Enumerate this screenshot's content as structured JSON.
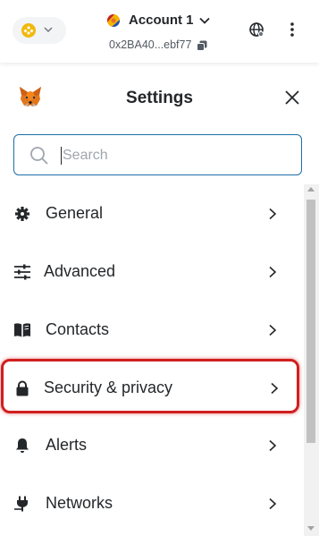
{
  "header": {
    "account_name": "Account 1",
    "account_address": "0x2BA40...ebf77",
    "network_icon": "bnb-chain-icon",
    "colors": {
      "network": "#f0b90b"
    }
  },
  "settings": {
    "title": "Settings",
    "search_placeholder": "Search"
  },
  "menu": {
    "items": [
      {
        "label": "General",
        "icon": "gear-icon"
      },
      {
        "label": "Advanced",
        "icon": "sliders-icon"
      },
      {
        "label": "Contacts",
        "icon": "book-icon"
      },
      {
        "label": "Security & privacy",
        "icon": "lock-icon",
        "highlighted": true
      },
      {
        "label": "Alerts",
        "icon": "bell-icon"
      },
      {
        "label": "Networks",
        "icon": "plug-icon"
      }
    ]
  },
  "colors": {
    "highlight": "#d01f1f",
    "search_border": "#1d6ea8",
    "text": "#24272a"
  }
}
